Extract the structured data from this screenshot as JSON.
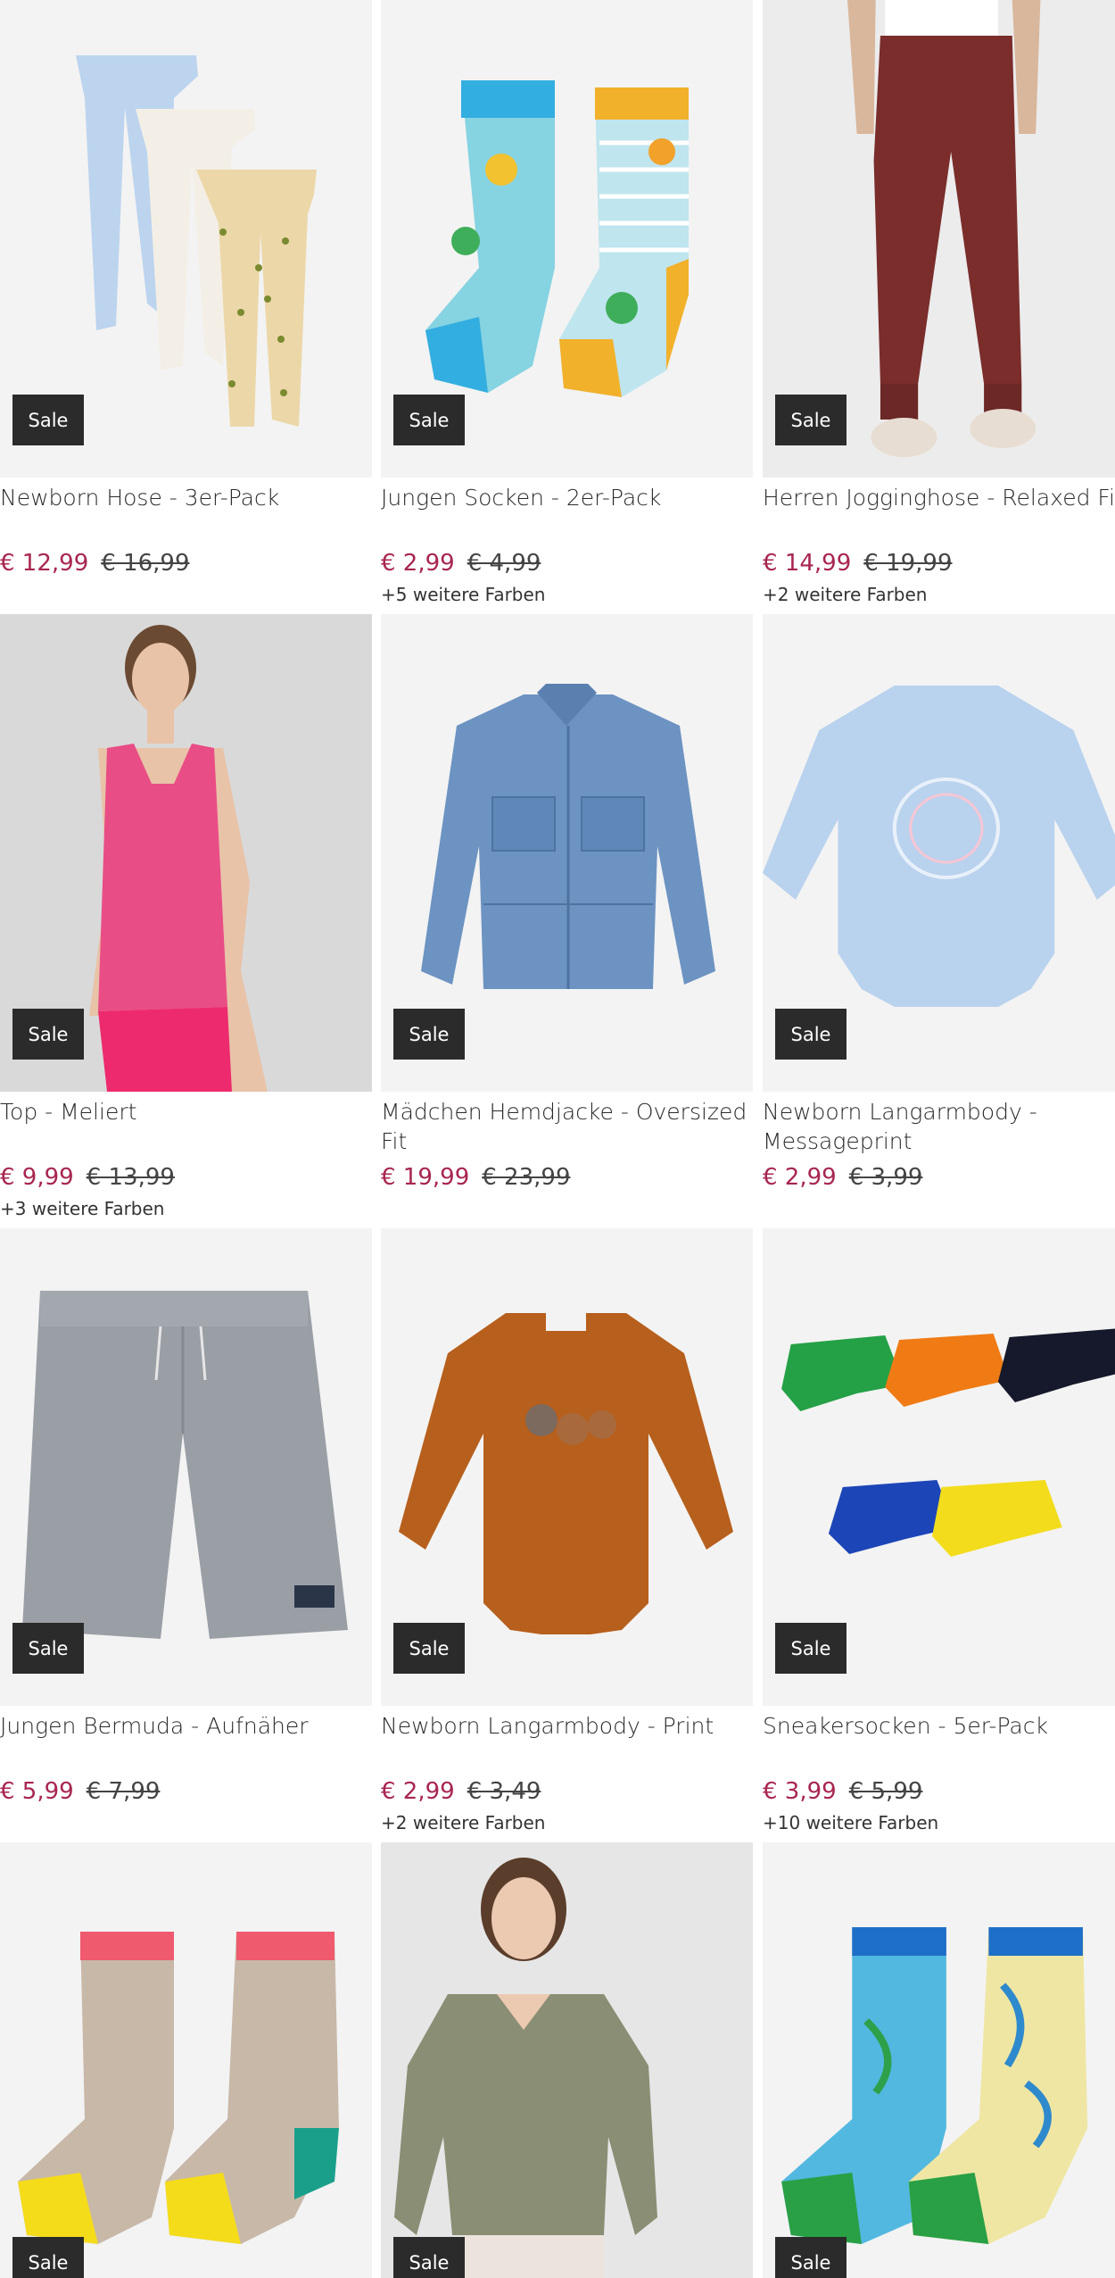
{
  "sale_label": "Sale",
  "colors": {
    "accent_price": "#a8264f",
    "badge_bg": "#2b2b2b",
    "image_bg": "#f3f3f3"
  },
  "products": [
    {
      "title": "Newborn Hose - 3er-Pack",
      "price": "€ 12,99",
      "old_price": "€ 16,99",
      "more_colors": "",
      "image": "baby-pants-3pack"
    },
    {
      "title": "Jungen Socken - 2er-Pack",
      "price": "€ 2,99",
      "old_price": "€ 4,99",
      "more_colors": "+5 weitere Farben",
      "image": "monster-socks"
    },
    {
      "title": "Herren Jogginghose - Relaxed Fit",
      "price": "€ 14,99",
      "old_price": "€ 19,99",
      "more_colors": "+2 weitere Farben",
      "image": "maroon-joggers"
    },
    {
      "title": "Top - Meliert",
      "price": "€ 9,99",
      "old_price": "€ 13,99",
      "more_colors": "+3 weitere Farben",
      "image": "pink-tank-top"
    },
    {
      "title": "Mädchen Hemdjacke - Oversized Fit",
      "price": "€ 19,99",
      "old_price": "€ 23,99",
      "more_colors": "",
      "image": "denim-shirt-jacket"
    },
    {
      "title": "Newborn Langarmbody - Messageprint",
      "price": "€ 2,99",
      "old_price": "€ 3,99",
      "more_colors": "",
      "image": "blue-bodysuit"
    },
    {
      "title": "Jungen Bermuda - Aufnäher",
      "price": "€ 5,99",
      "old_price": "€ 7,99",
      "more_colors": "",
      "image": "grey-shorts"
    },
    {
      "title": "Newborn Langarmbody - Print",
      "price": "€ 2,99",
      "old_price": "€ 3,49",
      "more_colors": "+2 weitere Farben",
      "image": "orange-bodysuit"
    },
    {
      "title": "Sneakersocken - 5er-Pack",
      "price": "€ 3,99",
      "old_price": "€ 5,99",
      "more_colors": "+10 weitere Farben",
      "image": "sneaker-socks-5pack"
    },
    {
      "title": "",
      "price": "",
      "old_price": "",
      "more_colors": "",
      "image": "flamingo-socks"
    },
    {
      "title": "",
      "price": "",
      "old_price": "",
      "more_colors": "",
      "image": "green-sweater"
    },
    {
      "title": "",
      "price": "",
      "old_price": "",
      "more_colors": "",
      "image": "jungle-socks"
    }
  ]
}
